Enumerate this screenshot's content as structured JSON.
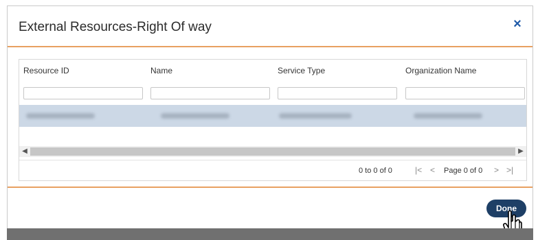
{
  "dialog": {
    "title": "External Resources-Right Of way",
    "close_icon": "×"
  },
  "grid": {
    "columns": [
      "Resource ID",
      "Name",
      "Service Type",
      "Organization Name"
    ]
  },
  "pager": {
    "range_text": "0 to 0 of 0",
    "page_text": "Page 0 of 0",
    "first_icon": "|<",
    "prev_icon": "<",
    "next_icon": ">",
    "last_icon": ">|"
  },
  "footer": {
    "done_label": "Done"
  },
  "colors": {
    "accent_line": "#e8a060",
    "close_icon": "#1f5aa8",
    "done_button": "#1e3f66",
    "selected_row": "#ccd8e6"
  }
}
